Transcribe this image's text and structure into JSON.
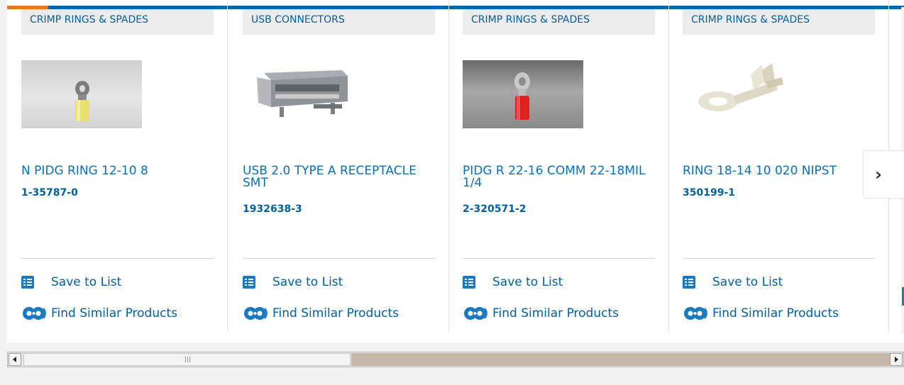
{
  "products": [
    {
      "category": "CRIMP RINGS & SPADES",
      "name": "N PIDG RING 12-10 8",
      "part_number": "1-35787-0",
      "image": "yellow-ring-terminal-image",
      "save_label": "Save to List",
      "similar_label": "Find Similar Products"
    },
    {
      "category": "USB CONNECTORS",
      "name": "USB 2.0 TYPE A RECEPTACLE SMT",
      "part_number": "1932638-3",
      "image": "usb-receptacle-image",
      "save_label": "Save to List",
      "similar_label": "Find Similar Products"
    },
    {
      "category": "CRIMP RINGS & SPADES",
      "name": "PIDG R 22-16 COMM 22-18MIL 1/4",
      "part_number": "2-320571-2",
      "image": "red-ring-terminal-image",
      "save_label": "Save to List",
      "similar_label": "Find Similar Products"
    },
    {
      "category": "CRIMP RINGS & SPADES",
      "name": "RING 18-14 10 020 NIPST",
      "part_number": "350199-1",
      "image": "bare-ring-terminal-image",
      "save_label": "Save to List",
      "similar_label": "Find Similar Products"
    }
  ],
  "carousel": {
    "next_icon": "chevron-right-icon",
    "scroll_thumb_icon": "grip-icon"
  },
  "colors": {
    "accent_orange": "#e87722",
    "brand_blue": "#0064a8",
    "link_blue": "#0a6fb7",
    "category_bg": "#ececec"
  }
}
